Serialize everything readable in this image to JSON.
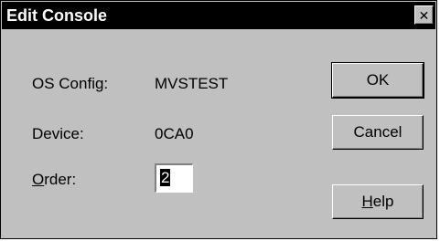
{
  "window": {
    "title": "Edit Console",
    "close_glyph": "✕"
  },
  "fields": {
    "os_config_label": "OS Config:",
    "os_config_value": "MVSTEST",
    "device_label": "Device:",
    "device_value": "0CA0",
    "order_label_mnemonic": "O",
    "order_label_rest": "rder:",
    "order_value": "2"
  },
  "buttons": {
    "ok_label": "OK",
    "cancel_label": "Cancel",
    "help_mnemonic": "H",
    "help_rest": "elp"
  }
}
